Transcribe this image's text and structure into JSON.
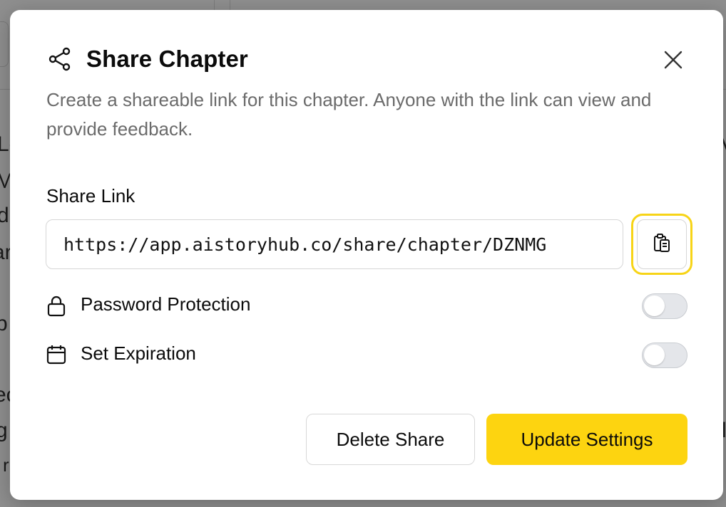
{
  "background": {
    "fragments_left": [
      "Lo",
      "M",
      "d",
      "ar",
      "b",
      "ec",
      "g",
      "r"
    ],
    "fragments_right": [
      "V",
      "",
      "",
      "",
      "",
      "",
      "l",
      ""
    ]
  },
  "modal": {
    "title": "Share Chapter",
    "title_icon": "share-icon",
    "close_icon": "close-icon",
    "description": "Create a shareable link for this chapter. Anyone with the link can view and provide feedback.",
    "share_link": {
      "label": "Share Link",
      "value": "https://app.aistoryhub.co/share/chapter/DZNMG",
      "copy_icon": "clipboard-copy-icon"
    },
    "options": [
      {
        "label": "Password Protection",
        "icon": "lock-icon",
        "enabled": false
      },
      {
        "label": "Set Expiration",
        "icon": "calendar-icon",
        "enabled": false
      }
    ],
    "buttons": {
      "delete_label": "Delete Share",
      "update_label": "Update Settings"
    }
  },
  "colors": {
    "accent": "#fdd410",
    "focus_ring": "#f7d417",
    "muted_text": "#6b6b6b",
    "overlay": "#8f8f8f"
  }
}
